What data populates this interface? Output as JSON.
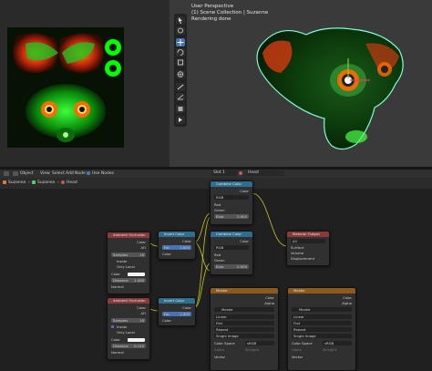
{
  "viewport": {
    "mode_line": "User Perspective",
    "collection_line": "(1) Scene Collection | Suzanne",
    "status_line": "Rendering done"
  },
  "node_header": {
    "object_mode": "Object",
    "menus": [
      "View",
      "Select",
      "Add",
      "Node"
    ],
    "use_nodes": "Use Nodes",
    "slot": "Slot 1",
    "material": "Head"
  },
  "breadcrumb": {
    "items": [
      "Suzanne",
      "Suzanne",
      "Head"
    ]
  },
  "nodes": {
    "ao1": {
      "title": "Ambient Occlusion",
      "color_out": "Color",
      "ao_out": "AO",
      "samples_label": "Samples",
      "samples": "16",
      "inside": "Inside",
      "only_local": "Only Local",
      "color_in": "Color",
      "distance_label": "Distance",
      "distance": "1.000",
      "normal": "Normal"
    },
    "ao2": {
      "title": "Ambient Occlusion",
      "color_out": "Color",
      "ao_out": "AO",
      "samples_label": "Samples",
      "samples": "16",
      "inside": "Inside",
      "only_local": "Only Local",
      "color_in": "Color",
      "distance_label": "Distance",
      "distance": "0.150",
      "normal": "Normal"
    },
    "invert1": {
      "title": "Invert Color",
      "color_out": "Color",
      "fac_label": "Fac",
      "fac": "1.000",
      "color_in": "Color"
    },
    "invert2": {
      "title": "Invert Color",
      "color_out": "Color",
      "fac_label": "Fac",
      "fac": "1.000",
      "color_in": "Color"
    },
    "combine1": {
      "title": "Combine Color",
      "color_out": "Color",
      "mode": "RGB",
      "red": "Red",
      "green": "Green",
      "blue_label": "Blue",
      "blue": "0.000"
    },
    "combine2": {
      "title": "Combine Color",
      "color_out": "Color",
      "mode": "RGB",
      "red": "Red",
      "green": "Green",
      "blue_label": "Blue",
      "blue": "0.000"
    },
    "output": {
      "title": "Material Output",
      "target": "All",
      "surface": "Surface",
      "volume": "Volume",
      "displacement": "Displacement"
    },
    "tex1": {
      "title": "Monke",
      "color_out": "Color",
      "alpha_out": "Alpha",
      "image": "Monke",
      "interp": "Linear",
      "proj": "Flat",
      "ext": "Repeat",
      "source": "Single Image",
      "cs_label": "Color Space",
      "cs": "sRGB",
      "alpha_label": "Alpha",
      "alpha": "Straight",
      "vector": "Vector"
    },
    "tex2": {
      "title": "Monke",
      "color_out": "Color",
      "alpha_out": "Alpha",
      "image": "Monke",
      "interp": "Linear",
      "proj": "Flat",
      "ext": "Repeat",
      "source": "Single Image",
      "cs_label": "Color Space",
      "cs": "sRGB",
      "alpha_label": "Alpha",
      "alpha": "Straight",
      "vector": "Vector"
    }
  },
  "colors": {
    "node_header_ao": "#8b3a3a",
    "node_header_color": "#2f6e8f",
    "node_header_output": "#8b3a3a",
    "node_header_texture": "#8c5a1e",
    "field_blue": "#4772b3",
    "link_yellow": "#c7c729"
  }
}
